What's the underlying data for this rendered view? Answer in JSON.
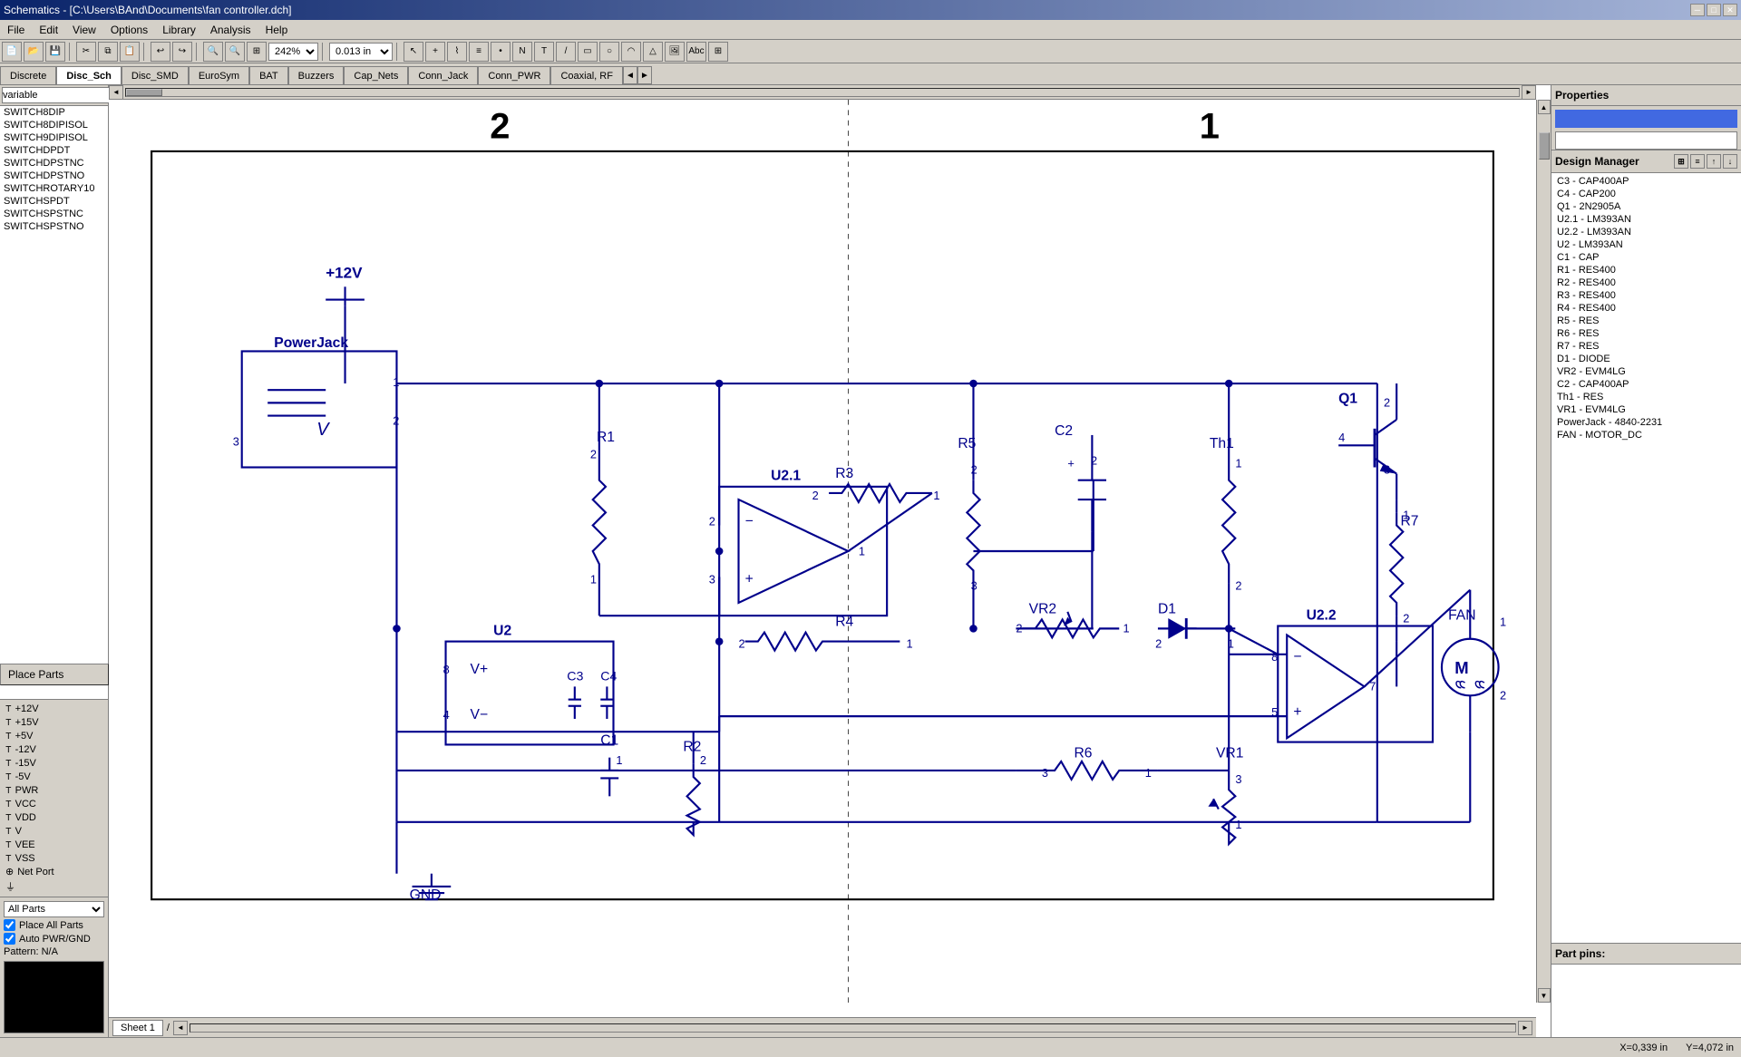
{
  "title": "Schematics - [C:\\Users\\BAnd\\Documents\\fan controller.dch]",
  "titlebar": {
    "minimize": "─",
    "maximize": "□",
    "close": "✕"
  },
  "menu": {
    "items": [
      "File",
      "Edit",
      "View",
      "Options",
      "Library",
      "Analysis",
      "Help"
    ]
  },
  "toolbar": {
    "zoom_value": "242%",
    "grid_value": "0.013 in"
  },
  "tabs": {
    "items": [
      "Discrete",
      "Disc_Sch",
      "Disc_SMD",
      "EuroSym",
      "BAT",
      "Buzzers",
      "Cap_Nets",
      "Conn_Jack",
      "Conn_PWR",
      "Coaxial, RF"
    ],
    "active": "Disc_Sch"
  },
  "left_panel": {
    "search_placeholder": "variable",
    "parts": [
      "SWITCH8DIP",
      "SWITCH8DIPISOL",
      "SWITCH9DIPISOL",
      "SWITCHDPDT",
      "SWITCHDPSTNC",
      "SWITCHDPSTNO",
      "SWITCHROTARY10",
      "SWITCHSPDT",
      "SWITCHSPSTNC",
      "SWITCHSPSTNO"
    ],
    "net_ports": [
      "+12V",
      "+15V",
      "+5V",
      "-12V",
      "-15V",
      "-5V",
      "PWR",
      "VCC",
      "VDD",
      "V",
      "VEE",
      "VSS"
    ],
    "net_port_label": "Net Port",
    "filter_options": [
      "All Parts"
    ],
    "place_parts_checked": true,
    "place_parts_label": "Place All Parts",
    "auto_pwr_gnd_checked": true,
    "auto_pwr_gnd_label": "Auto PWR/GND",
    "pattern_label": "Pattern: N/A",
    "place_parts_btn": "Place Parts"
  },
  "right_panel": {
    "properties_title": "Properties",
    "design_manager_title": "Design Manager",
    "design_manager_items": [
      "C3 - CAP400AP",
      "C4 - CAP200",
      "Q1 - 2N2905A",
      "U2.1 - LM393AN",
      "U2.2 - LM393AN",
      "U2 - LM393AN",
      "C1 - CAP",
      "R1 - RES400",
      "R2 - RES400",
      "R3 - RES400",
      "R4 - RES400",
      "R5 - RES",
      "R6 - RES",
      "R7 - RES",
      "D1 - DIODE",
      "VR2 - EVM4LG",
      "C2 - CAP400AP",
      "Th1 - RES",
      "VR1 - EVM4LG",
      "PowerJack - 4840-2231",
      "FAN - MOTOR_DC"
    ],
    "part_pins_title": "Part pins:"
  },
  "status_bar": {
    "x_coord": "X=0,339 in",
    "y_coord": "Y=4,072 in"
  },
  "sheet": {
    "tab_label": "Sheet 1"
  },
  "schematic": {
    "grid_label_2": "2",
    "grid_label_1": "1",
    "components": {
      "power_jack_label": "PowerJack",
      "plus12v_label": "+12V",
      "r3_label": "R3",
      "u21_label": "U2.1",
      "r4_label": "R4",
      "c2_label": "C2",
      "th1_label": "Th1",
      "q1_label": "Q1",
      "r7_label": "R7",
      "vr2_label": "VR2",
      "d1_label": "D1",
      "u22_label": "U2.2",
      "fan_label": "FAN",
      "r6_label": "R6",
      "vr1_label": "VR1",
      "u2_label": "U2",
      "c3_label": "C3",
      "c4_label": "C4",
      "r2_label": "R2",
      "r1_label": "R1",
      "r5_label": "R5",
      "gnd_label": "GND",
      "c1_label": "C1"
    }
  }
}
